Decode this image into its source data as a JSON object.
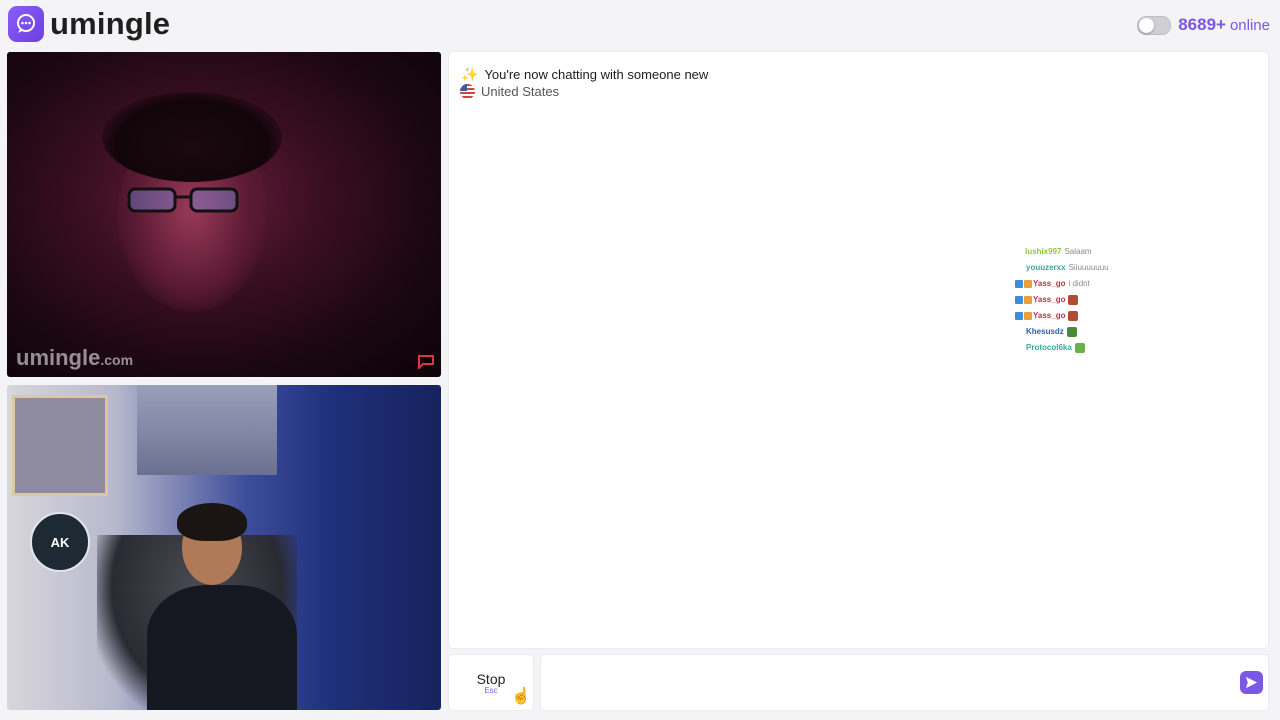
{
  "header": {
    "brand": "umingle",
    "online_count": "8689+",
    "online_label": "online",
    "accent": "#7b57e6"
  },
  "videos": {
    "stranger_watermark": "umingle",
    "stranger_watermark_suffix": ".com",
    "self_avatar_text": "AK"
  },
  "chat": {
    "system_message": "You're now chatting with someone new",
    "country": "United States",
    "overlay": [
      {
        "user": "lushix997",
        "user_color": "#8cc63f",
        "msg": "Salaam",
        "badges": 0
      },
      {
        "user": "youuzerxx",
        "user_color": "#3aa89a",
        "msg": "Siiuuuuuuu",
        "badges": 0
      },
      {
        "user": "Yass_go",
        "user_color": "#c0304a",
        "msg": "i didnt",
        "badges": 2
      },
      {
        "user": "Yass_go",
        "user_color": "#c0304a",
        "msg": "",
        "badges": 2,
        "emote": "#b34a3a"
      },
      {
        "user": "Yass_go",
        "user_color": "#c0304a",
        "msg": "",
        "badges": 2,
        "emote": "#b34a3a"
      },
      {
        "user": "Khesusdz",
        "user_color": "#2e5fa8",
        "msg": "",
        "badges": 0,
        "emote": "#4a8a3a"
      },
      {
        "user": "Protocol6ka",
        "user_color": "#3aa89a",
        "msg": "",
        "badges": 0,
        "emote": "#6ab04c"
      }
    ]
  },
  "controls": {
    "stop_label": "Stop",
    "stop_hint": "Esc",
    "input_placeholder": ""
  }
}
